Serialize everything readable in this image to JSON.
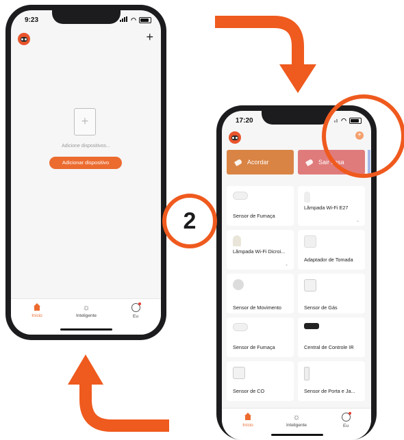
{
  "left_phone": {
    "status_time": "9:23",
    "add_icon": "+",
    "empty_message": "Adicione dispositivos...",
    "add_button_label": "Adicionar dispositivo",
    "tabs": [
      {
        "label": "Início",
        "icon": "home-icon"
      },
      {
        "label": "Inteligente",
        "icon": "sun-icon"
      },
      {
        "label": "Eu",
        "icon": "user-icon"
      }
    ]
  },
  "right_phone": {
    "status_time": "17:20",
    "scenes": [
      {
        "label": "Acordar",
        "color": "#d98445"
      },
      {
        "label": "Sair casa",
        "color": "#e07b7b"
      }
    ],
    "devices": [
      {
        "name": "Sensor de Fumaça"
      },
      {
        "name": "Lâmpada Wi-Fi E27"
      },
      {
        "name": "Lâmpada Wi-Fi Dicroi..."
      },
      {
        "name": "Adaptador de Tomada"
      },
      {
        "name": "Sensor de Movimento"
      },
      {
        "name": "Sensor de Gás"
      },
      {
        "name": "Sensor de Fumaça"
      },
      {
        "name": "Central de Controle IR"
      },
      {
        "name": "Sensor de CO"
      },
      {
        "name": "Sensor de Porta e Ja..."
      }
    ],
    "tabs": [
      {
        "label": "Início",
        "icon": "home-icon"
      },
      {
        "label": "Inteligente",
        "icon": "sun-icon"
      },
      {
        "label": "Eu",
        "icon": "user-icon"
      }
    ]
  },
  "step_badge": "2",
  "colors": {
    "accent": "#ec6b2f",
    "annotation": "#ef5a1e"
  }
}
